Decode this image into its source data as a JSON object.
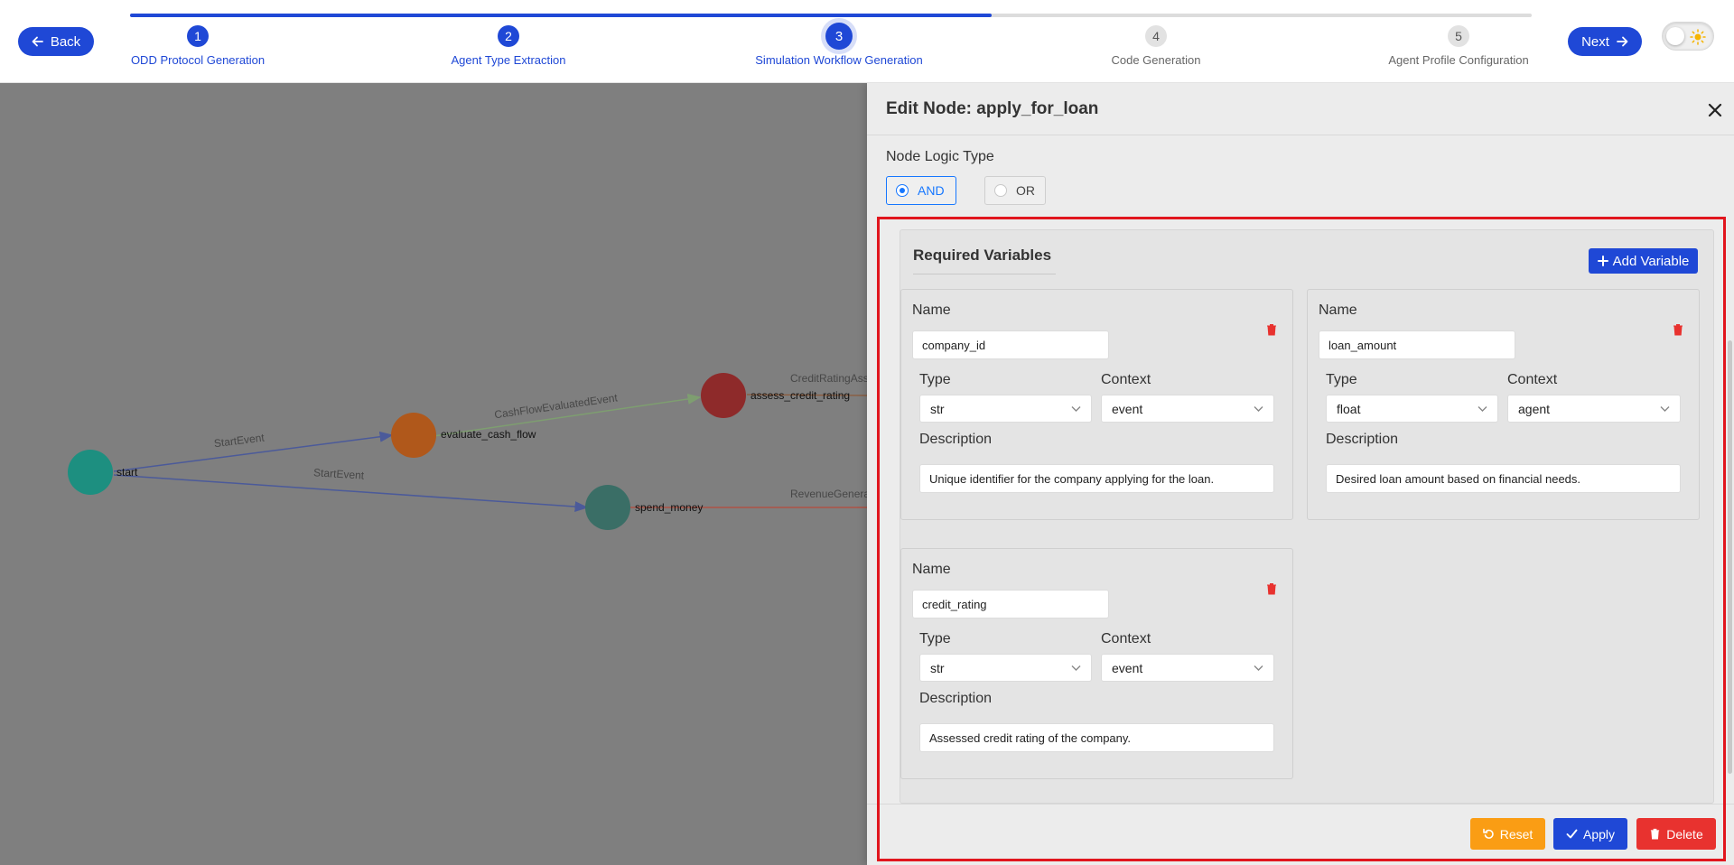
{
  "nav": {
    "back_label": "Back",
    "next_label": "Next",
    "progress_fraction": 0.615,
    "steps": [
      {
        "num": "1",
        "label": "ODD Protocol Generation"
      },
      {
        "num": "2",
        "label": "Agent Type Extraction"
      },
      {
        "num": "3",
        "label": "Simulation Workflow Generation"
      },
      {
        "num": "4",
        "label": "Code Generation"
      },
      {
        "num": "5",
        "label": "Agent Profile Configuration"
      }
    ]
  },
  "graph": {
    "nodes": [
      {
        "id": "start",
        "label": "start",
        "color": "#1d8f80"
      },
      {
        "id": "evaluate_cash_flow",
        "label": "evaluate_cash_flow",
        "color": "#b0581b"
      },
      {
        "id": "assess_credit_rating",
        "label": "assess_credit_rating",
        "color": "#8e2a2a"
      },
      {
        "id": "spend_money",
        "label": "spend_money",
        "color": "#3a6e66"
      }
    ],
    "edges": [
      {
        "label": "StartEvent",
        "color": "#4b5a9a"
      },
      {
        "label": "StartEvent",
        "color": "#4b5a9a"
      },
      {
        "label": "CashFlowEvaluatedEvent",
        "color": "#7e9e70"
      },
      {
        "label": "CreditRatingAss",
        "color": "#8c5a3a"
      },
      {
        "label": "RevenueGenera",
        "color": "#b84a3a"
      }
    ]
  },
  "panel": {
    "title": "Edit Node: apply_for_loan",
    "logic_label": "Node Logic Type",
    "logic_options": [
      "AND",
      "OR"
    ],
    "logic_selected": "AND",
    "vars_title": "Required Variables",
    "add_variable_label": "Add Variable",
    "field_labels": {
      "name": "Name",
      "type": "Type",
      "context": "Context",
      "description": "Description"
    },
    "variables": [
      {
        "name": "company_id",
        "type": "str",
        "context": "event",
        "description": "Unique identifier for the company applying for the loan."
      },
      {
        "name": "loan_amount",
        "type": "float",
        "context": "agent",
        "description": "Desired loan amount based on financial needs."
      },
      {
        "name": "credit_rating",
        "type": "str",
        "context": "event",
        "description": "Assessed credit rating of the company."
      }
    ],
    "reset_label": "Reset",
    "apply_label": "Apply",
    "delete_label": "Delete"
  },
  "colors": {
    "primary": "#1f48d6",
    "reset": "#fa9d14",
    "delete": "#e8322f",
    "highlight": "#e1161e"
  }
}
